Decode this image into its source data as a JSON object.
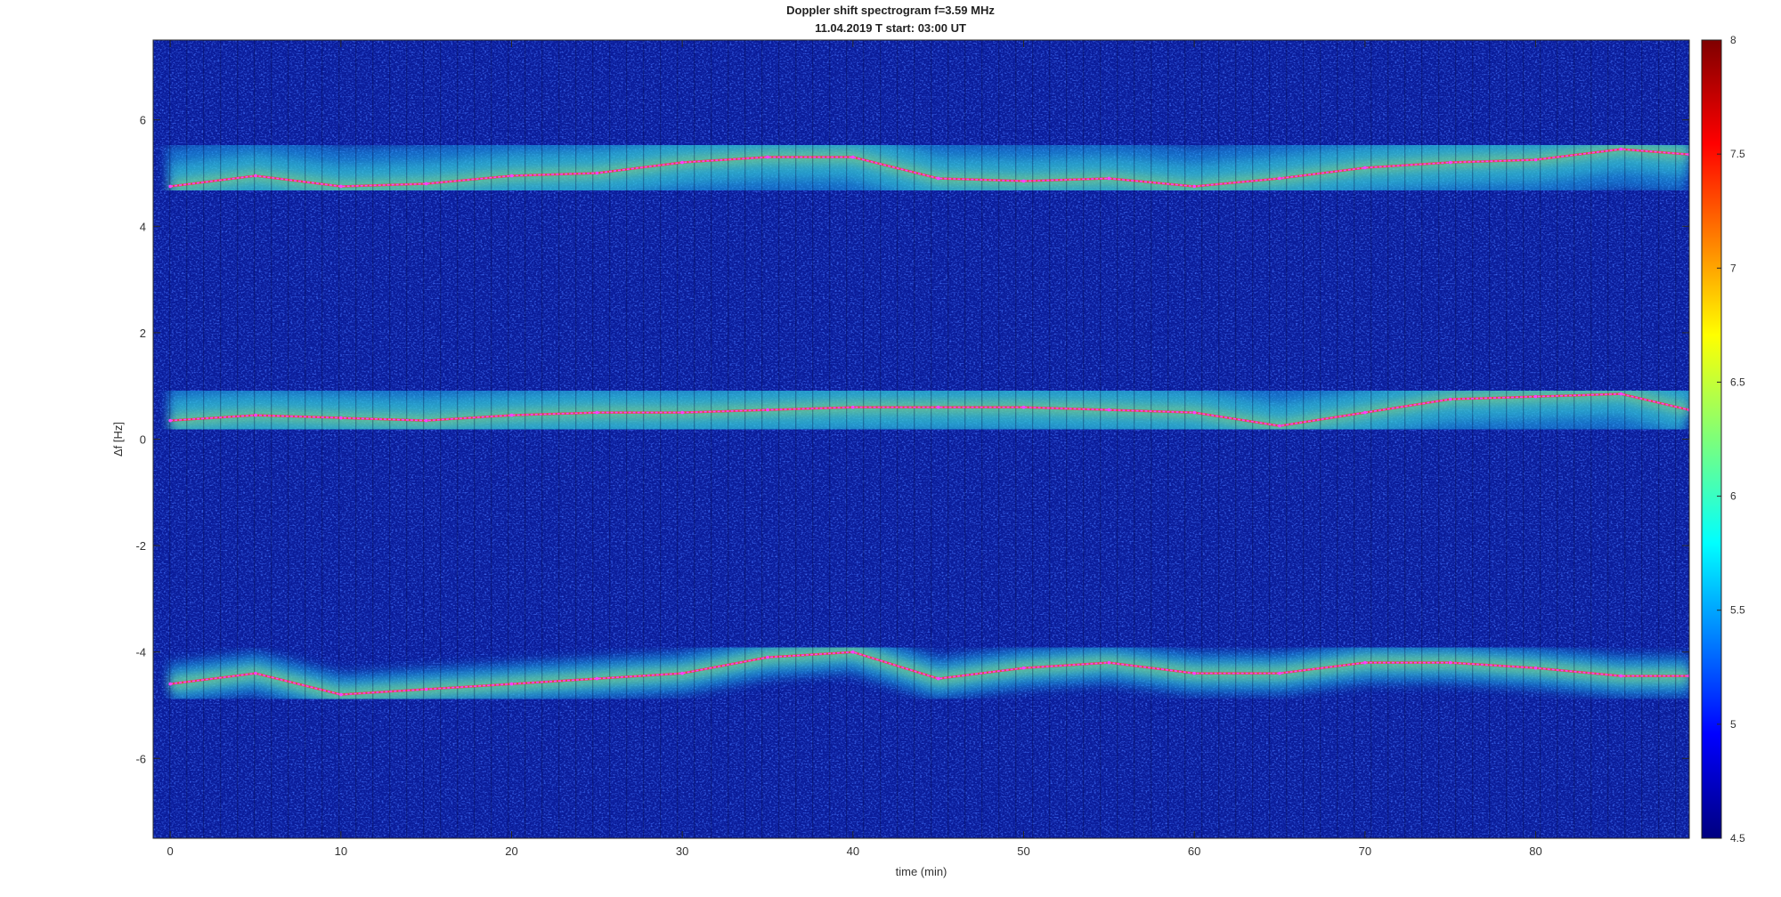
{
  "chart_data": {
    "type": "heatmap",
    "title": "Doppler shift spectrogram f=3.59 MHz",
    "subtitle": "11.04.2019    T start: 03:00 UT",
    "xlabel": "time (min)",
    "ylabel": "Δf [Hz]",
    "xlim": [
      -1,
      89
    ],
    "ylim": [
      -7.5,
      7.5
    ],
    "xticks": [
      0,
      10,
      20,
      30,
      40,
      50,
      60,
      70,
      80
    ],
    "yticks": [
      -6,
      -4,
      -2,
      0,
      2,
      4,
      6
    ],
    "colorbar": {
      "colormap": "jet",
      "range": [
        4.5,
        8
      ],
      "ticks": [
        4.5,
        5,
        5.5,
        6,
        6.5,
        7,
        7.5,
        8
      ]
    },
    "grid": false,
    "series": [
      {
        "color": "#ff40ff",
        "x": [
          0,
          5,
          10,
          15,
          20,
          25,
          30,
          35,
          40,
          45,
          50,
          55,
          60,
          65,
          70,
          75,
          80,
          85,
          89
        ],
        "y": [
          4.75,
          4.95,
          4.75,
          4.8,
          4.95,
          5.0,
          5.2,
          5.3,
          5.3,
          4.9,
          4.85,
          4.9,
          4.75,
          4.9,
          5.1,
          5.2,
          5.25,
          5.45,
          5.35
        ]
      },
      {
        "color": "#ff40ff",
        "x": [
          0,
          5,
          10,
          15,
          20,
          25,
          30,
          35,
          40,
          45,
          50,
          55,
          60,
          65,
          70,
          75,
          80,
          85,
          89
        ],
        "y": [
          0.35,
          0.45,
          0.4,
          0.35,
          0.45,
          0.5,
          0.5,
          0.55,
          0.6,
          0.6,
          0.6,
          0.55,
          0.5,
          0.25,
          0.5,
          0.75,
          0.8,
          0.85,
          0.55
        ]
      },
      {
        "color": "#ff40ff",
        "x": [
          0,
          5,
          10,
          15,
          20,
          25,
          30,
          35,
          40,
          45,
          50,
          55,
          60,
          65,
          70,
          75,
          80,
          85,
          89
        ],
        "y": [
          -4.6,
          -4.4,
          -4.8,
          -4.7,
          -4.6,
          -4.5,
          -4.4,
          -4.1,
          -4.0,
          -4.5,
          -4.3,
          -4.2,
          -4.4,
          -4.4,
          -4.2,
          -4.2,
          -4.3,
          -4.45,
          -4.45
        ]
      }
    ]
  }
}
